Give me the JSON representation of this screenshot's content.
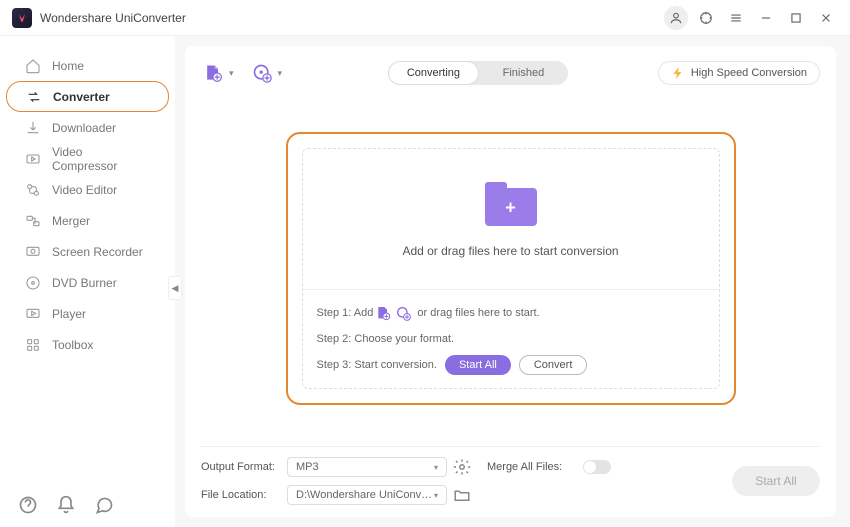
{
  "app": {
    "title": "Wondershare UniConverter"
  },
  "sidebar": {
    "items": [
      {
        "label": "Home",
        "icon": "home"
      },
      {
        "label": "Converter",
        "icon": "converter"
      },
      {
        "label": "Downloader",
        "icon": "downloader"
      },
      {
        "label": "Video Compressor",
        "icon": "compressor"
      },
      {
        "label": "Video Editor",
        "icon": "editor"
      },
      {
        "label": "Merger",
        "icon": "merger"
      },
      {
        "label": "Screen Recorder",
        "icon": "recorder"
      },
      {
        "label": "DVD Burner",
        "icon": "dvd"
      },
      {
        "label": "Player",
        "icon": "player"
      },
      {
        "label": "Toolbox",
        "icon": "toolbox"
      }
    ],
    "active_index": 1
  },
  "tabs": {
    "converting": "Converting",
    "finished": "Finished",
    "active": "converting"
  },
  "high_speed_label": "High Speed Conversion",
  "dropzone": {
    "main_text": "Add or drag files here to start conversion",
    "step1_prefix": "Step 1: Add",
    "step1_suffix": "or drag files here to start.",
    "step2": "Step 2: Choose your format.",
    "step3_prefix": "Step 3: Start conversion.",
    "start_all_label": "Start All",
    "convert_label": "Convert"
  },
  "footer": {
    "output_format_label": "Output Format:",
    "output_format_value": "MP3",
    "file_location_label": "File Location:",
    "file_location_value": "D:\\Wondershare UniConverter",
    "merge_label": "Merge All Files:",
    "start_all_label": "Start All"
  }
}
